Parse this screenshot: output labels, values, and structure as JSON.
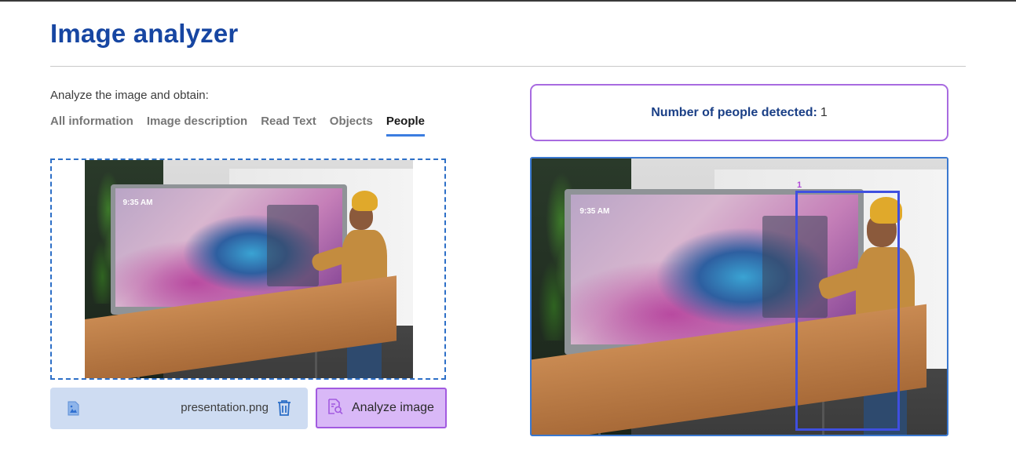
{
  "page": {
    "title": "Image analyzer"
  },
  "analyze": {
    "subtitle": "Analyze the image and obtain:",
    "tabs": [
      {
        "label": "All information",
        "active": false
      },
      {
        "label": "Image description",
        "active": false
      },
      {
        "label": "Read Text",
        "active": false
      },
      {
        "label": "Objects",
        "active": false
      },
      {
        "label": "People",
        "active": true
      }
    ]
  },
  "upload": {
    "file_name": "presentation.png",
    "file_icon": "image-file-icon",
    "delete_icon": "trash-icon",
    "analyze_button_label": "Analyze image",
    "analyze_icon": "document-search-icon"
  },
  "photo": {
    "screen_clock": "9:35 AM"
  },
  "result": {
    "label": "Number of people detected:",
    "value": "1",
    "detections": [
      {
        "label": "1"
      }
    ]
  },
  "colors": {
    "title": "#1746a2",
    "active_tab_underline": "#3b7de0",
    "analyze_button_bg": "#d9b8f7",
    "analyze_button_border": "#a25ae0",
    "result_border": "#a86be0",
    "bbox": "#3f4fe0"
  }
}
